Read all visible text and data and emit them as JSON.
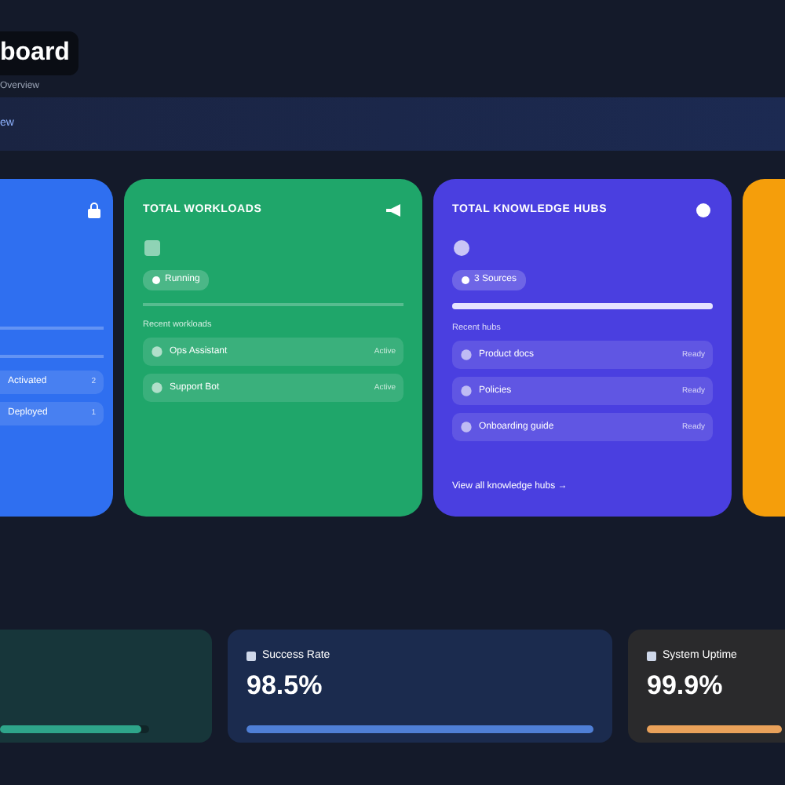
{
  "header": {
    "title": "board",
    "subtitle": "Overview"
  },
  "nav": {
    "label": "ew"
  },
  "cards": [
    {
      "kind": "partial",
      "color": "#2f6ff0",
      "rows": [
        {
          "name": "Activated",
          "value": "2"
        },
        {
          "name": "Deployed",
          "value": "1"
        }
      ]
    },
    {
      "kind": "full",
      "color": "#1fa66a",
      "title": "TOTAL WORKLOADS",
      "status": "Running",
      "section": "Recent workloads",
      "rows": [
        {
          "name": "Ops Assistant",
          "value": "Active"
        },
        {
          "name": "Support Bot",
          "value": "Active"
        }
      ]
    },
    {
      "kind": "full",
      "color": "#4a3fe0",
      "title": "TOTAL KNOWLEDGE HUBS",
      "status": "3 Sources",
      "level": 1,
      "section": "Recent hubs",
      "rows": [
        {
          "name": "Product docs",
          "value": "Ready"
        },
        {
          "name": "Policies",
          "value": "Ready"
        },
        {
          "name": "Onboarding guide",
          "value": "Ready"
        }
      ],
      "link": "View all knowledge hubs →"
    },
    {
      "kind": "edge",
      "color": "#f59e0b"
    }
  ],
  "stats": [
    {
      "kind": "edge",
      "color": "#2ea58a",
      "level": 0.95
    },
    {
      "kind": "full",
      "color": "#4f7fd6",
      "label": "Success Rate",
      "value": "98.5%",
      "level": 1
    },
    {
      "kind": "full",
      "color": "#e9a15a",
      "label": "System Uptime",
      "value": "99.9%",
      "level": 1
    }
  ]
}
